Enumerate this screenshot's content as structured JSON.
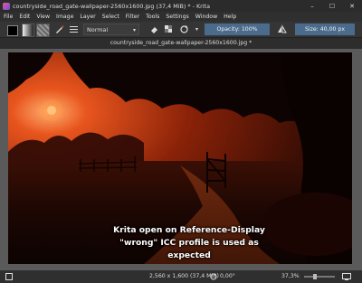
{
  "window": {
    "title": "countryside_road_gate-wallpaper-2560x1600.jpg (37,4 MiB)  * - Krita",
    "controls": [
      "–",
      "☐",
      "✕"
    ]
  },
  "menu": [
    "File",
    "Edit",
    "View",
    "Image",
    "Layer",
    "Select",
    "Filter",
    "Tools",
    "Settings",
    "Window",
    "Help"
  ],
  "toolbar": {
    "blend_mode": "Normal",
    "opacity_label": "Opacity: 100%",
    "size_label": "Size: 40,00 px"
  },
  "document_tab": "countryside_road_gate-wallpaper-2560x1600.jpg *",
  "caption": {
    "line1": "Krita open on Reference-Display",
    "line2": "\"wrong\" ICC profile is used as",
    "line3": "expected"
  },
  "status": {
    "dimensions": "2,560 x 1,600 (37,4 MiB)",
    "rotation": "0,00°",
    "zoom": "37,3%"
  },
  "colors": {
    "accent": "#4a6b8c",
    "sky_glow": "#e8551e",
    "sun": "#ffd9a0"
  }
}
